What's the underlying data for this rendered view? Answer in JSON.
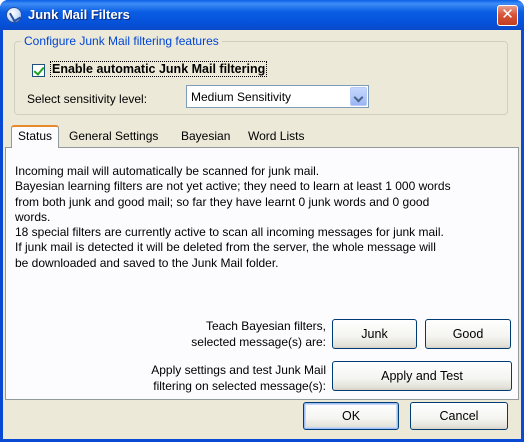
{
  "window": {
    "title": "Junk Mail Filters",
    "close_glyph": "✕",
    "icon": "app-icon"
  },
  "group": {
    "legend": "Configure Junk Mail filtering features",
    "enable_label": "Enable automatic Junk Mail filtering",
    "enable_checked": true,
    "sensitivity_label": "Select sensitivity level:",
    "sensitivity_value": "Medium Sensitivity"
  },
  "tabs": [
    {
      "label": "Status",
      "active": true
    },
    {
      "label": "General Settings",
      "active": false
    },
    {
      "label": "Bayesian",
      "active": false
    },
    {
      "label": "Word Lists",
      "active": false
    }
  ],
  "status": {
    "lines": [
      "Incoming mail will automatically be scanned for junk mail.",
      "Bayesian learning filters are not yet active; they need to learn at least 1 000 words",
      "from both junk and good mail; so far they have learnt 0 junk words and 0 good",
      "words.",
      "18 special filters are currently active to scan all incoming messages for junk mail.",
      "If junk mail is detected it will be deleted from the server, the whole message will",
      "be downloaded and saved to the Junk Mail folder."
    ],
    "teach_line1": "Teach Bayesian filters,",
    "teach_line2": "selected message(s) are:",
    "apply_line1": "Apply settings and test Junk Mail",
    "apply_line2": "filtering on selected message(s):"
  },
  "buttons": {
    "junk": "Junk",
    "good": "Good",
    "apply_test": "Apply and Test",
    "ok": "OK",
    "cancel": "Cancel"
  },
  "colors": {
    "title_bar": "#0a5ee3",
    "dialog_bg": "#ece9d8",
    "group_legend": "#0046d5",
    "tab_highlight": "#e68b2c"
  }
}
